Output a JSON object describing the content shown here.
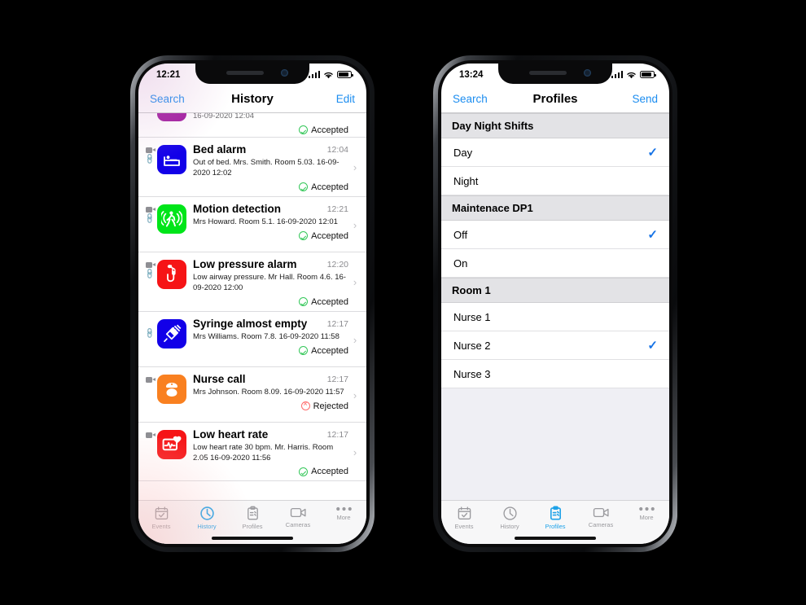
{
  "phone_history": {
    "status_bar": {
      "time": "12:21",
      "signal_icon": "cellular-bars-icon",
      "wifi_icon": "wifi-icon",
      "battery_icon": "battery-icon"
    },
    "nav": {
      "left_label": "Search",
      "title": "History",
      "right_label": "Edit"
    },
    "rows": [
      {
        "clipped": true,
        "icon_color": "#a0189e",
        "icon_glyph": "clipped-icon",
        "title": "",
        "desc": "16-09-2020 12:04",
        "time": "",
        "status": "Accepted",
        "status_kind": "accepted",
        "has_camera": false,
        "has_link": false
      },
      {
        "clipped": false,
        "icon_color": "#1200e8",
        "icon_glyph": "bed-icon",
        "title": "Bed alarm",
        "desc": "Out of bed. Mrs. Smith. Room 5.03. 16-09-2020 12:02",
        "time": "12:04",
        "status": "Accepted",
        "status_kind": "accepted",
        "has_camera": true,
        "has_link": true
      },
      {
        "clipped": false,
        "icon_color": "#00e519",
        "icon_glyph": "motion-detection-icon",
        "title": "Motion detection",
        "desc": "Mrs Howard. Room 5.1.  16-09-2020 12:01",
        "time": "12:21",
        "status": "Accepted",
        "status_kind": "accepted",
        "has_camera": true,
        "has_link": true
      },
      {
        "clipped": false,
        "icon_color": "#f61416",
        "icon_glyph": "low-pressure-alarm-icon",
        "title": "Low pressure alarm",
        "desc": "Low airway pressure. Mr Hall. Room 4.6. 16-09-2020 12:00",
        "time": "12:20",
        "status": "Accepted",
        "status_kind": "accepted",
        "has_camera": true,
        "has_link": true
      },
      {
        "clipped": false,
        "icon_color": "#1200e8",
        "icon_glyph": "syringe-icon",
        "title": "Syringe almost empty",
        "desc": "Mrs Williams. Room 7.8.  16-09-2020 11:58",
        "time": "12:17",
        "status": "Accepted",
        "status_kind": "accepted",
        "has_camera": false,
        "has_link": true
      },
      {
        "clipped": false,
        "icon_color": "#f98020",
        "icon_glyph": "nurse-call-icon",
        "title": "Nurse call",
        "desc": "Mrs Johnson. Room 8.09. 16-09-2020 11:57",
        "time": "12:17",
        "status": "Rejected",
        "status_kind": "rejected",
        "has_camera": true,
        "has_link": false
      },
      {
        "clipped": false,
        "icon_color": "#f61416",
        "icon_glyph": "low-heart-rate-icon",
        "title": "Low heart rate",
        "desc": "Low heart rate 30 bpm. Mr. Harris. Room 2.05 16-09-2020 11:56",
        "time": "12:17",
        "status": "Accepted",
        "status_kind": "accepted",
        "has_camera": true,
        "has_link": false
      }
    ],
    "tabs": [
      {
        "label": "Events",
        "icon": "calendar-check-icon",
        "active": false
      },
      {
        "label": "History",
        "icon": "clock-icon",
        "active": true
      },
      {
        "label": "Profiles",
        "icon": "clipboard-icon",
        "active": false
      },
      {
        "label": "Cameras",
        "icon": "video-camera-icon",
        "active": false
      },
      {
        "label": "More",
        "icon": "ellipsis-icon",
        "active": false
      }
    ]
  },
  "phone_profiles": {
    "status_bar": {
      "time": "13:24",
      "signal_icon": "cellular-bars-icon",
      "wifi_icon": "wifi-icon",
      "battery_icon": "battery-icon"
    },
    "nav": {
      "left_label": "Search",
      "title": "Profiles",
      "right_label": "Send"
    },
    "sections": [
      {
        "header": "Day Night Shifts",
        "options": [
          {
            "label": "Day",
            "selected": true
          },
          {
            "label": "Night",
            "selected": false
          }
        ]
      },
      {
        "header": "Maintenace DP1",
        "options": [
          {
            "label": "Off",
            "selected": true
          },
          {
            "label": "On",
            "selected": false
          }
        ]
      },
      {
        "header": "Room 1",
        "options": [
          {
            "label": "Nurse 1",
            "selected": false
          },
          {
            "label": "Nurse 2",
            "selected": true
          },
          {
            "label": "Nurse 3",
            "selected": false
          }
        ]
      }
    ],
    "tabs": [
      {
        "label": "Events",
        "icon": "calendar-check-icon",
        "active": false
      },
      {
        "label": "History",
        "icon": "clock-icon",
        "active": false
      },
      {
        "label": "Profiles",
        "icon": "clipboard-icon",
        "active": true
      },
      {
        "label": "Cameras",
        "icon": "video-camera-icon",
        "active": false
      },
      {
        "label": "More",
        "icon": "ellipsis-icon",
        "active": false
      }
    ]
  },
  "theme": {
    "accent_blue": "#1c8df0",
    "tab_active": "#1fa2e8",
    "accepted_green": "#34c759",
    "rejected_red": "#ff6b6b",
    "checkmark_blue": "#1673e6"
  },
  "checkmark_glyph": "✓",
  "chevron_glyph": "›"
}
